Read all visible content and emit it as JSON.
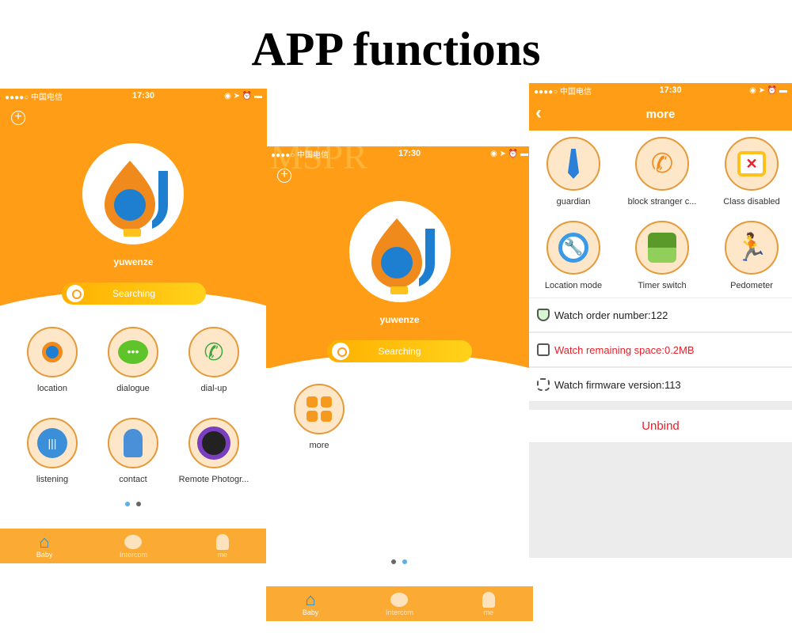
{
  "title": "APP functions",
  "watermark": "MSPR",
  "status": {
    "carrier": "●●●●○ 中国电信",
    "time": "17:30"
  },
  "colors": {
    "orange": "#ff9e16",
    "tabbar": "#fbaa33",
    "active_tab": "#1e90d8",
    "red": "#e8202a"
  },
  "home": {
    "name": "yuwenze",
    "search": "Searching",
    "page1_items": [
      {
        "label": "location",
        "icon": "logo-icon"
      },
      {
        "label": "dialogue",
        "icon": "chat-icon"
      },
      {
        "label": "dial-up",
        "icon": "phone-icon"
      },
      {
        "label": "listening",
        "icon": "audio-icon"
      },
      {
        "label": "contact",
        "icon": "contact-icon"
      },
      {
        "label": "Remote Photogr...",
        "icon": "camera-icon"
      }
    ],
    "page2_items": [
      {
        "label": "more",
        "icon": "grid-icon"
      }
    ]
  },
  "tabs": [
    {
      "label": "Baby",
      "icon": "home-icon",
      "active": true
    },
    {
      "label": "Intercom",
      "icon": "chat-bubble-icon"
    },
    {
      "label": "me",
      "icon": "person-icon"
    }
  ],
  "more": {
    "title": "more",
    "items": [
      {
        "label": "guardian",
        "icon": "tie-icon"
      },
      {
        "label": "block stranger c...",
        "icon": "block-call-icon"
      },
      {
        "label": "Class disabled",
        "icon": "calendar-x-icon"
      },
      {
        "label": "Location  mode",
        "icon": "wrench-pin-icon"
      },
      {
        "label": "Timer switch",
        "icon": "toggle-icon"
      },
      {
        "label": "Pedometer",
        "icon": "runner-icon"
      }
    ],
    "rows": [
      {
        "text": "Watch order number:122",
        "icon": "shield-icon"
      },
      {
        "text": "Watch remaining space:0.2MB",
        "icon": "storage-icon",
        "warn": true
      },
      {
        "text": "Watch firmware version:113",
        "icon": "puzzle-icon"
      }
    ],
    "unbind": "Unbind"
  }
}
